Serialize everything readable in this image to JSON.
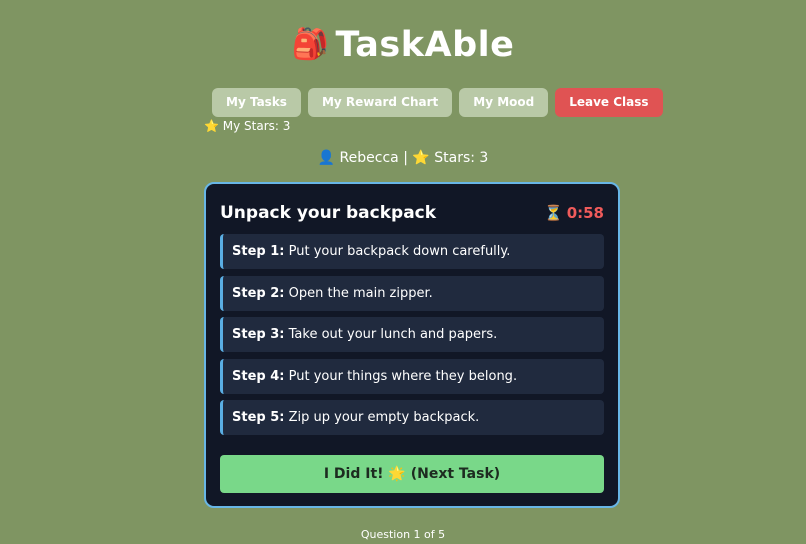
{
  "app": {
    "logo_glyph": "🎒",
    "title": "TaskAble"
  },
  "nav": {
    "items": [
      {
        "label": "My Tasks"
      },
      {
        "label": "My Reward Chart"
      },
      {
        "label": "My Mood"
      },
      {
        "label": "Leave Class"
      }
    ]
  },
  "stars": {
    "glyph": "⭐",
    "label": "My Stars: 3"
  },
  "user": {
    "glyph": "👤",
    "name": "Rebecca",
    "separator": "|",
    "star_glyph": "⭐",
    "stars_label": "Stars: 3"
  },
  "task": {
    "title": "Unpack your backpack",
    "timer_glyph": "⏳",
    "timer": "0:58",
    "steps": [
      {
        "label": "Step 1:",
        "text": "Put your backpack down carefully."
      },
      {
        "label": "Step 2:",
        "text": "Open the main zipper."
      },
      {
        "label": "Step 3:",
        "text": "Take out your lunch and papers."
      },
      {
        "label": "Step 4:",
        "text": "Put your things where they belong."
      },
      {
        "label": "Step 5:",
        "text": "Zip up your empty backpack."
      }
    ],
    "done_button": "I Did It! 🌟 (Next Task)"
  },
  "progress": {
    "label": "Question 1 of 5"
  },
  "colors": {
    "background": "#7f9562",
    "card": "#111726",
    "card_border": "#68b6e6",
    "step_bg": "#202a3e",
    "accent_green": "#79d889",
    "leave_red": "#e05353",
    "timer_red": "#ef5b5b"
  }
}
